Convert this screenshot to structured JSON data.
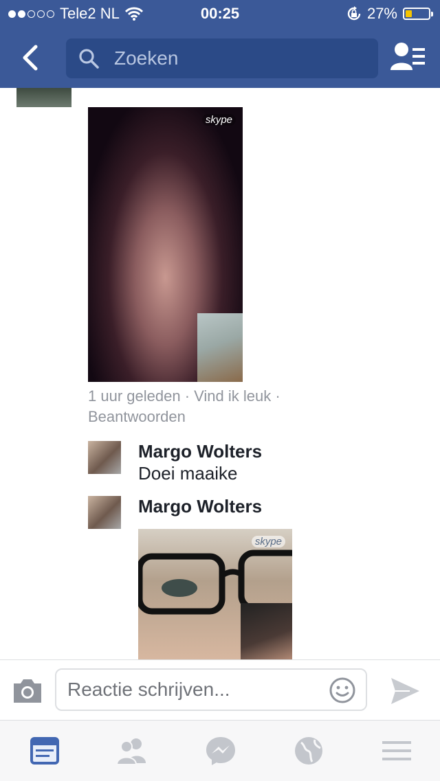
{
  "status_bar": {
    "carrier": "Tele2 NL",
    "time": "00:25",
    "battery_percent_text": "27%",
    "battery_level": 0.27,
    "signal_bars_filled": 2,
    "signal_bars_total": 5
  },
  "header": {
    "search_placeholder": "Zoeken",
    "icons": [
      "back-chevron-icon",
      "search-icon",
      "friends-list-icon"
    ]
  },
  "feed": {
    "post_meta": {
      "time": "1 uur geleden",
      "like": "Vind ik leuk",
      "reply": "Beantwoorden",
      "separator": "·"
    },
    "photo_watermark": "skype",
    "comments": [
      {
        "author": "Margo Wolters",
        "text": "Doei maaike"
      },
      {
        "author": "Margo Wolters",
        "text": ""
      }
    ]
  },
  "composer": {
    "placeholder": "Reactie schrijven...",
    "icons": [
      "camera-icon",
      "emoji-icon",
      "send-icon"
    ]
  },
  "tabbar": {
    "tabs": [
      "news-feed-icon",
      "friend-requests-icon",
      "messenger-icon",
      "notifications-globe-icon",
      "menu-icon"
    ],
    "active": "news-feed-icon",
    "active_color": "#4267b2",
    "inactive_color": "#c3c6cc"
  },
  "colors": {
    "brand": "#3b5998",
    "meta_text": "#90949c"
  }
}
